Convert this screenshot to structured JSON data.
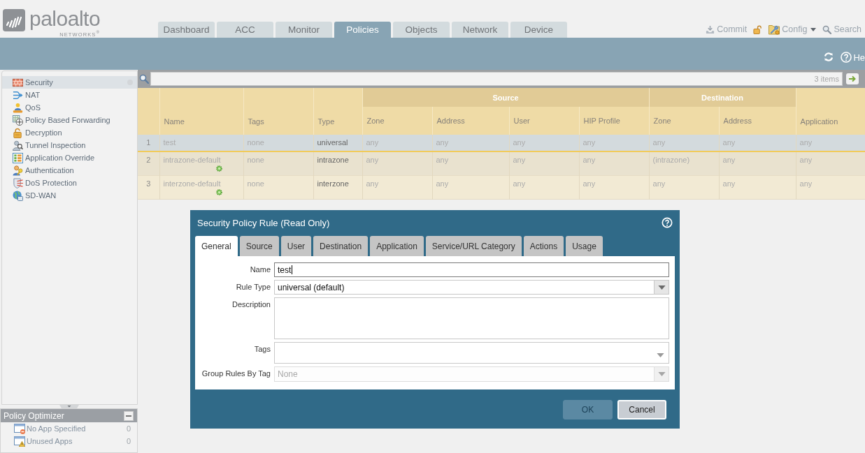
{
  "header": {
    "logo": {
      "wordmark": "paloalto",
      "subtitle": "NETWORKS$^{®}$"
    },
    "tabs": [
      {
        "label": "Dashboard",
        "selected": false
      },
      {
        "label": "ACC",
        "selected": false
      },
      {
        "label": "Monitor",
        "selected": false
      },
      {
        "label": "Policies",
        "selected": true
      },
      {
        "label": "Objects",
        "selected": false
      },
      {
        "label": "Network",
        "selected": false
      },
      {
        "label": "Device",
        "selected": false
      }
    ],
    "toolbar": {
      "commit": "Commit",
      "config": "Config",
      "search": "Search"
    }
  },
  "band": {
    "help": "He"
  },
  "sidebar": {
    "items": [
      {
        "label": "Security",
        "selected": true
      },
      {
        "label": "NAT",
        "selected": false
      },
      {
        "label": "QoS",
        "selected": false
      },
      {
        "label": "Policy Based Forwarding",
        "selected": false
      },
      {
        "label": "Decryption",
        "selected": false
      },
      {
        "label": "Tunnel Inspection",
        "selected": false
      },
      {
        "label": "Application Override",
        "selected": false
      },
      {
        "label": "Authentication",
        "selected": false
      },
      {
        "label": "DoS Protection",
        "selected": false
      },
      {
        "label": "SD-WAN",
        "selected": false
      }
    ],
    "optimizer": {
      "title": "Policy Optimizer",
      "items": [
        {
          "label": "No App Specified",
          "count": "0"
        },
        {
          "label": "Unused Apps",
          "count": "0"
        }
      ]
    }
  },
  "filter": {
    "count": "3 items"
  },
  "table": {
    "column_groups": [
      {
        "colspan": 3
      },
      {
        "label": "Source",
        "colspan": 4
      },
      {
        "label": "Destination",
        "colspan": 2
      }
    ],
    "columns": [
      "Name",
      "Tags",
      "Type",
      "Zone",
      "Address",
      "User",
      "HIP Profile",
      "Zone",
      "Address",
      "Application"
    ],
    "rows": [
      {
        "number": "1",
        "selected": true,
        "predefined": false,
        "cells": [
          "test",
          "none",
          "universal",
          "any",
          "any",
          "any",
          "any",
          "any",
          "any",
          "any"
        ]
      },
      {
        "number": "2",
        "selected": false,
        "predefined": true,
        "cells": [
          "intrazone-default",
          "none",
          "intrazone",
          "any",
          "any",
          "any",
          "any",
          "(intrazone)",
          "any",
          "any"
        ]
      },
      {
        "number": "3",
        "selected": false,
        "predefined": true,
        "cells": [
          "interzone-default",
          "none",
          "interzone",
          "any",
          "any",
          "any",
          "any",
          "any",
          "any",
          "any"
        ]
      }
    ]
  },
  "dialog": {
    "title": "Security Policy Rule (Read Only)",
    "tabs": [
      {
        "label": "General",
        "selected": true
      },
      {
        "label": "Source",
        "selected": false
      },
      {
        "label": "User",
        "selected": false
      },
      {
        "label": "Destination",
        "selected": false
      },
      {
        "label": "Application",
        "selected": false
      },
      {
        "label": "Service/URL Category",
        "selected": false
      },
      {
        "label": "Actions",
        "selected": false
      },
      {
        "label": "Usage",
        "selected": false
      }
    ],
    "fields": [
      {
        "label": "Name",
        "kind": "text",
        "value": "test",
        "focused": true,
        "disabled": false
      },
      {
        "label": "Rule Type",
        "kind": "select",
        "value": "universal (default)",
        "focused": false,
        "disabled": false
      },
      {
        "label": "Description",
        "kind": "textarea",
        "focused": false,
        "disabled": false
      },
      {
        "label": "Tags",
        "kind": "tags",
        "focused": false,
        "disabled": false
      },
      {
        "label": "Group Rules By Tag",
        "kind": "select",
        "value": "None",
        "focused": false,
        "disabled": true
      }
    ],
    "buttons": [
      {
        "label": "OK",
        "disabled": true
      },
      {
        "label": "Cancel",
        "disabled": false
      }
    ]
  }
}
